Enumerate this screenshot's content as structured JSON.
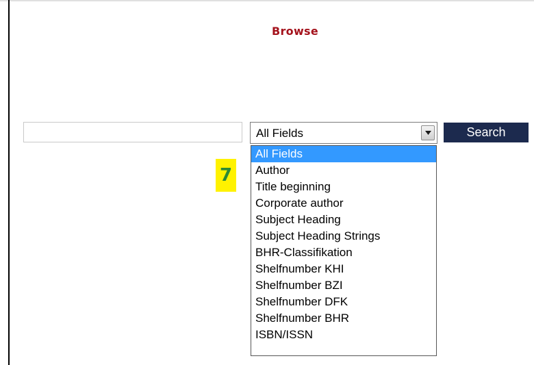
{
  "page": {
    "title": "Browse"
  },
  "search": {
    "input_value": "",
    "button_label": "Search"
  },
  "select": {
    "selected_value": "All Fields",
    "options": [
      "All Fields",
      "Author",
      "Title beginning",
      "Corporate author",
      "Subject Heading",
      "Subject Heading Strings",
      "BHR-Classifikation",
      "Shelfnumber KHI",
      "Shelfnumber BZI",
      "Shelfnumber DFK",
      "Shelfnumber BHR",
      "ISBN/ISSN"
    ],
    "highlighted_index": 0,
    "arrow_icon": "chevron-down-icon"
  },
  "annotation": {
    "step_number": "7"
  },
  "colors": {
    "title": "#a4121c",
    "search_button_bg": "#1c2a4e",
    "highlight": "#3399ff",
    "badge_bg": "#fff200",
    "badge_text": "#2d8a35"
  }
}
